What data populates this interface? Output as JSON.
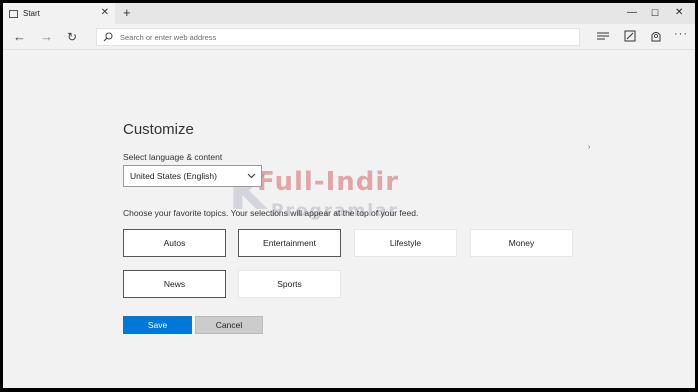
{
  "tab": {
    "title": "Start",
    "close_glyph": "✕"
  },
  "newtab_glyph": "+",
  "window": {
    "minimize": "—",
    "maximize": "☐",
    "close": "✕"
  },
  "nav": {
    "back": "←",
    "forward": "→",
    "refresh": "↻"
  },
  "address": {
    "placeholder": "Search or enter web address",
    "value": ""
  },
  "toolbar": {
    "more": "···"
  },
  "customize": {
    "title": "Customize",
    "language_label": "Select language & content",
    "language_value": "United States (English)",
    "topics_label": "Choose your favorite topics. Your selections will appear at the top of your feed.",
    "topics": [
      {
        "label": "Autos",
        "selected": true
      },
      {
        "label": "Entertainment",
        "selected": true
      },
      {
        "label": "Lifestyle",
        "selected": false
      },
      {
        "label": "Money",
        "selected": false
      },
      {
        "label": "News",
        "selected": true
      },
      {
        "label": "Sports",
        "selected": false
      }
    ],
    "save_label": "Save",
    "cancel_label": "Cancel"
  },
  "watermark": {
    "line1": "Full-Indir",
    "line2": "Programlar"
  },
  "cursor_glyph": "›",
  "colors": {
    "accent": "#0078d7",
    "background": "#f2f2f2",
    "tabbar": "#e6e6e6"
  },
  "icons": [
    "page-icon",
    "close-icon",
    "plus-icon",
    "back-arrow-icon",
    "forward-arrow-icon",
    "refresh-icon",
    "search-icon",
    "hub-icon",
    "web-note-icon",
    "share-icon",
    "more-icon",
    "chevron-down-icon"
  ]
}
